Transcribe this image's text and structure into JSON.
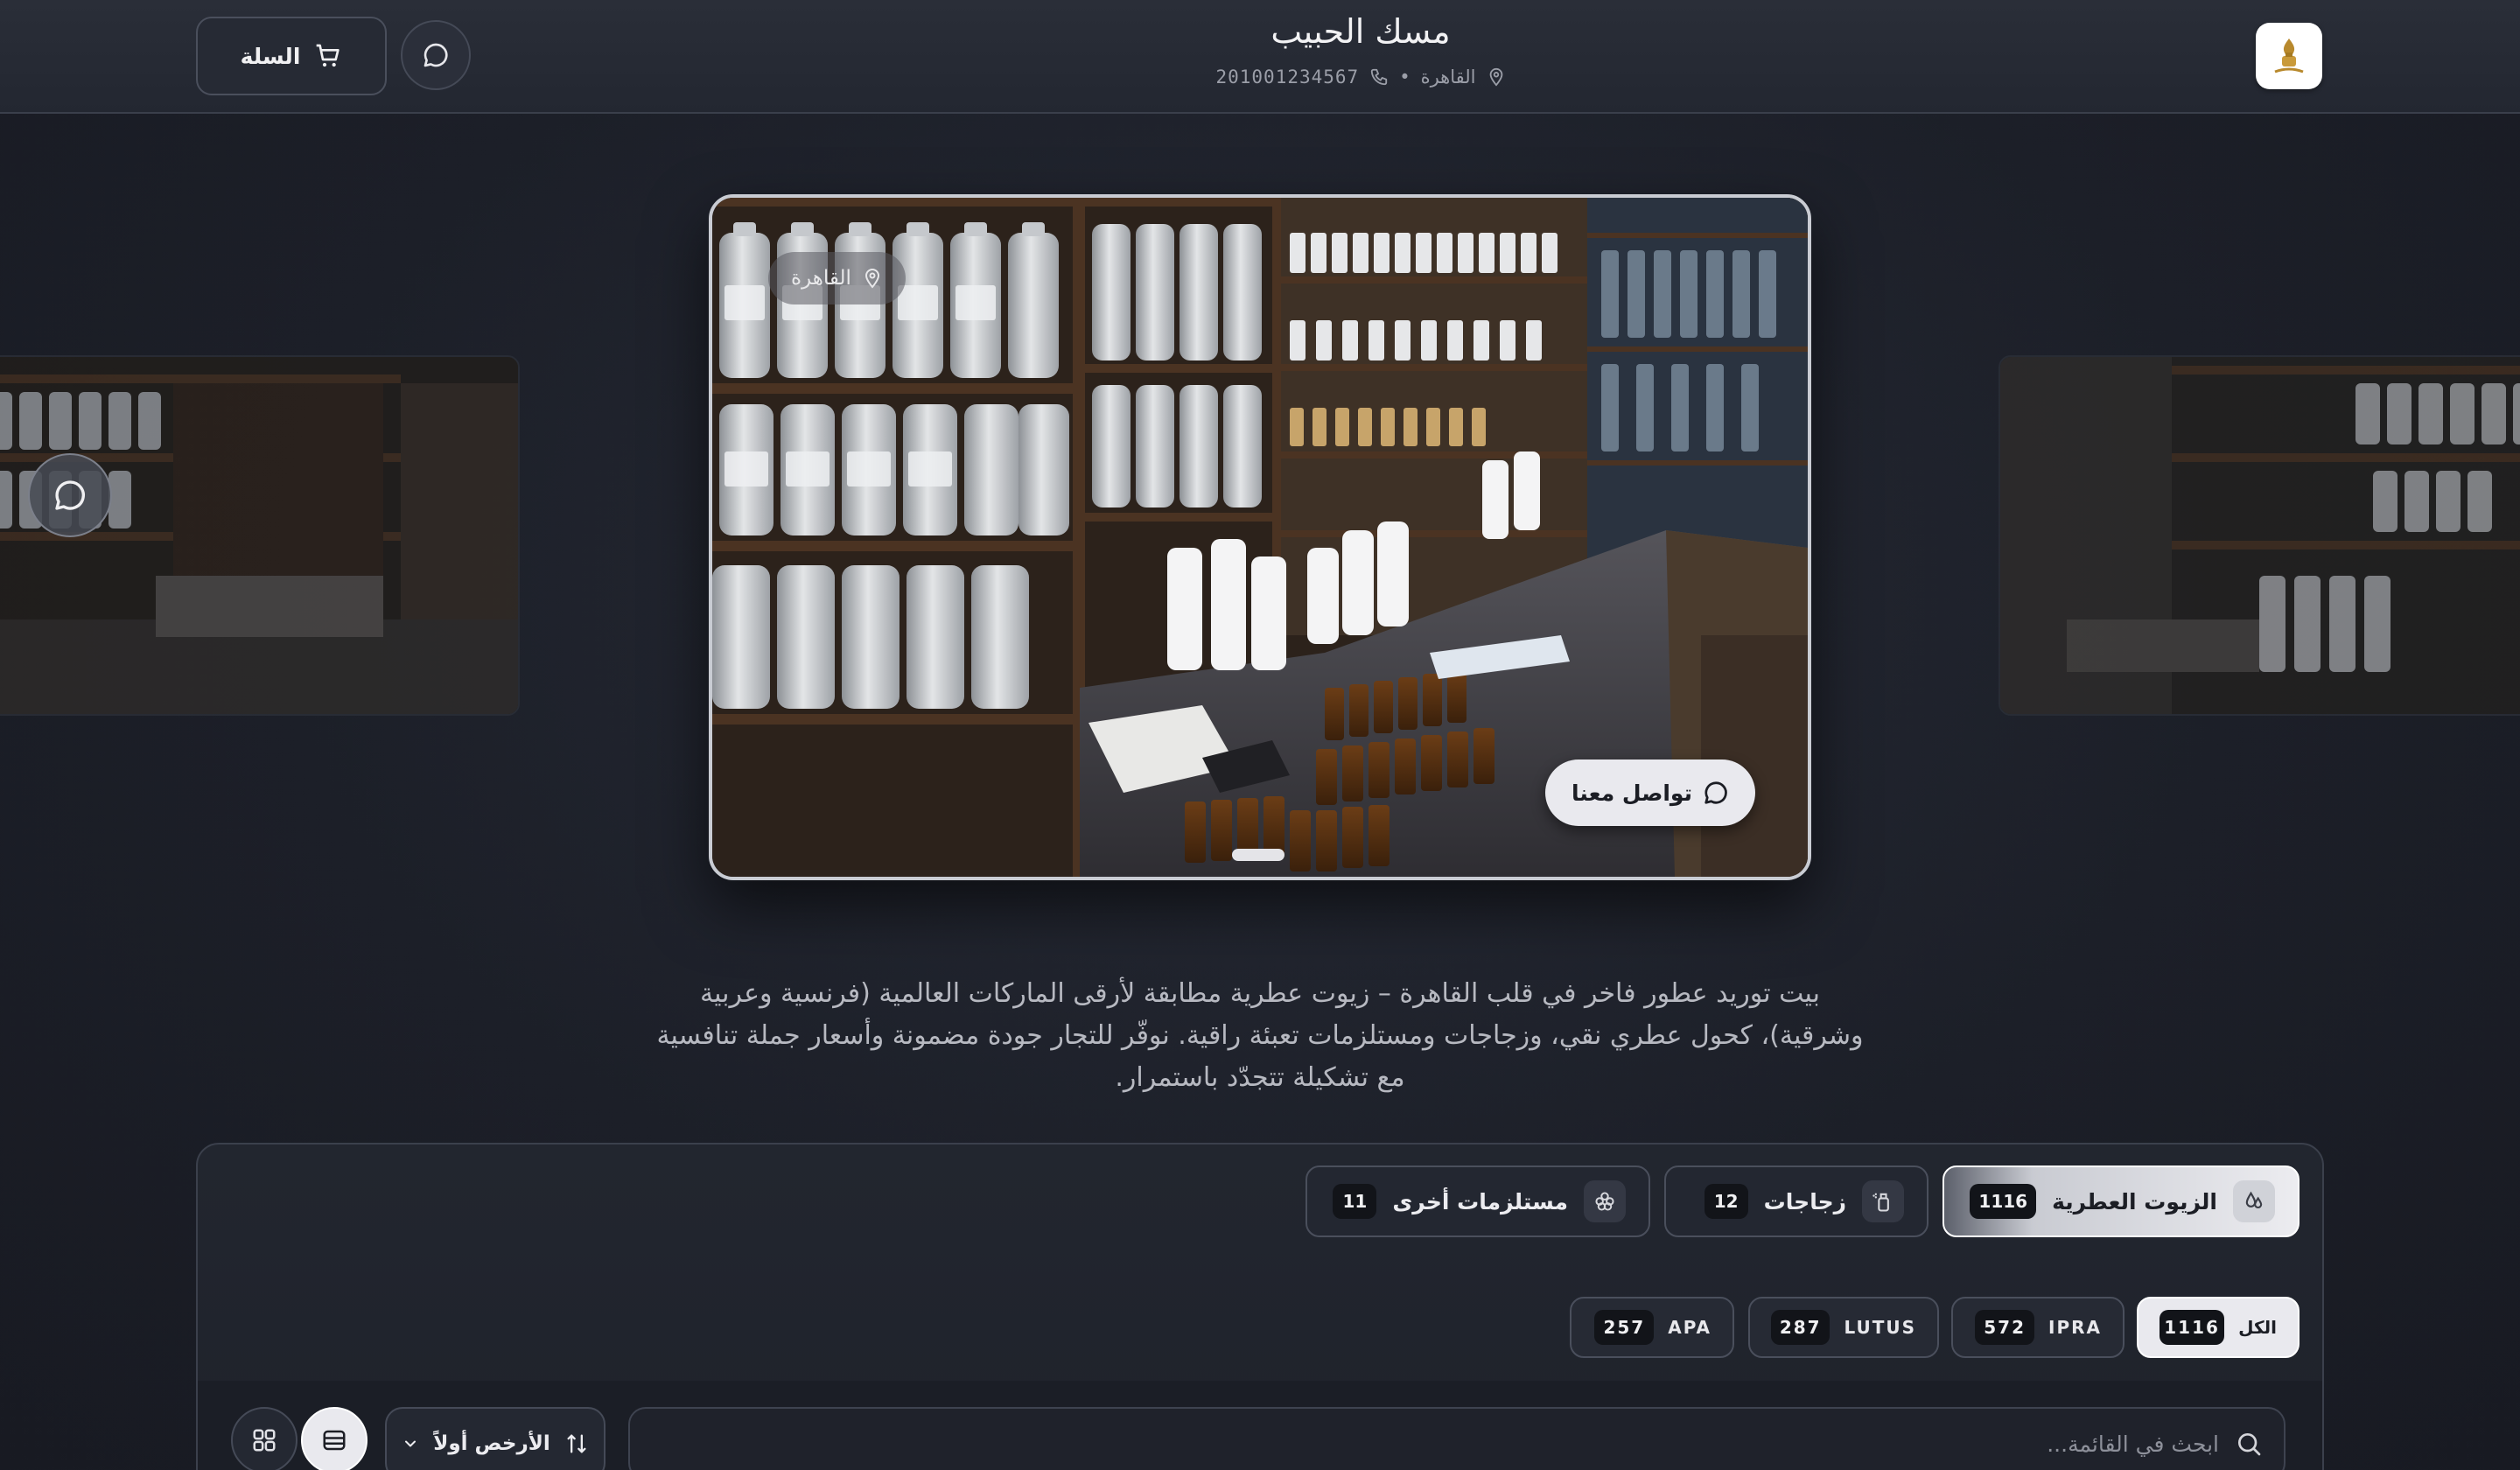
{
  "header": {
    "brand_name": "مسك الحبيب",
    "location": "القاهرة",
    "separator": "•",
    "phone": "201001234567",
    "cart_label": "السلة"
  },
  "hero": {
    "location_chip": "القاهرة",
    "contact_label": "تواصل معنا",
    "slides_count": 3,
    "active_slide": 1
  },
  "description": "بيت توريد عطور فاخر في قلب القاهرة – زيوت عطرية مطابقة لأرقى الماركات العالمية (فرنسية وعربية وشرقية)، كحول عطري نقي، وزجاجات ومستلزمات تعبئة راقية. نوفّر للتجار جودة مضمونة وأسعار جملة تنافسية مع تشكيلة تتجدّد باستمرار.",
  "categories": [
    {
      "label": "الزيوت العطرية",
      "count": "1116",
      "icon": "drops-icon",
      "active": true
    },
    {
      "label": "زجاجات",
      "count": "12",
      "icon": "spray-bottle-icon",
      "active": false
    },
    {
      "label": "مستلزمات أخرى",
      "count": "11",
      "icon": "flower-icon",
      "active": false
    }
  ],
  "brands": [
    {
      "label": "الكل",
      "count": "1116",
      "active": true
    },
    {
      "label": "IPRA",
      "count": "572",
      "active": false
    },
    {
      "label": "LUTUS",
      "count": "287",
      "active": false
    },
    {
      "label": "APA",
      "count": "257",
      "active": false
    }
  ],
  "toolbar": {
    "search_placeholder": "ابحث في القائمة...",
    "sort_label": "الأرخص أولاً"
  },
  "colors": {
    "background": "#1c1f28",
    "accent_light": "#e9e9ee",
    "badge_dark": "#121419"
  }
}
